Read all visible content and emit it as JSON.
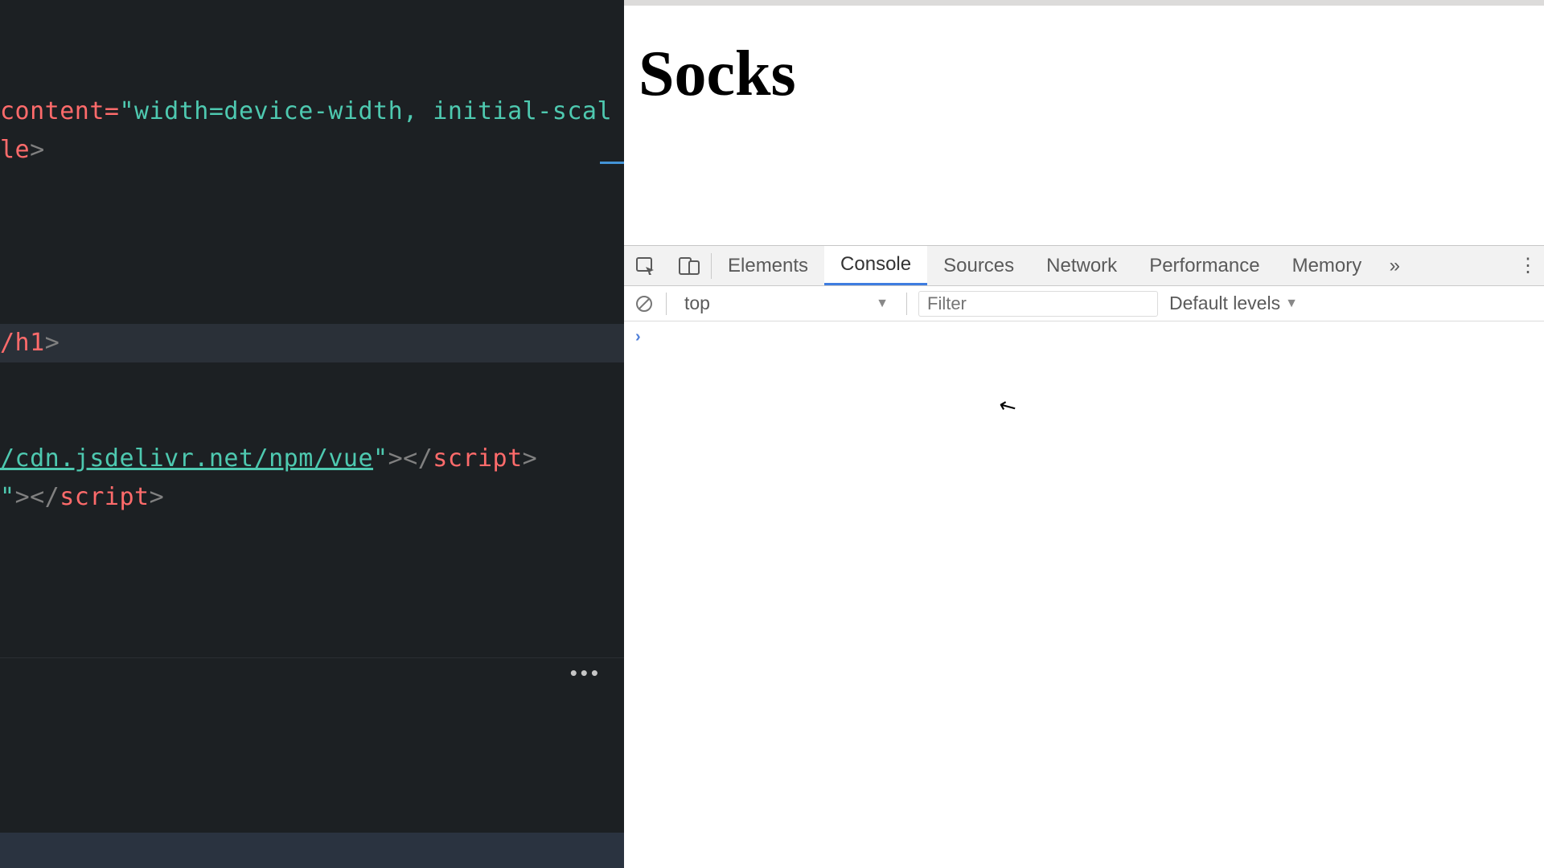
{
  "editor": {
    "lines": [
      {
        "segments": [
          {
            "t": "content=",
            "c": "red"
          },
          {
            "t": "\"width=device-width, initial-scal",
            "c": "teal"
          }
        ]
      },
      {
        "segments": [
          {
            "t": "le",
            "c": "red"
          },
          {
            "t": ">",
            "c": "gray"
          }
        ]
      },
      {
        "segments": []
      },
      {
        "segments": []
      },
      {
        "segments": []
      },
      {
        "segments": []
      },
      {
        "segments": [
          {
            "t": "/h1",
            "c": "red"
          },
          {
            "t": ">",
            "c": "gray"
          }
        ],
        "current": true
      },
      {
        "segments": []
      },
      {
        "segments": []
      },
      {
        "segments": [
          {
            "t": "/cdn.jsdelivr.net/npm/vue",
            "c": "teal",
            "u": true
          },
          {
            "t": "\"",
            "c": "teal"
          },
          {
            "t": "></",
            "c": "gray"
          },
          {
            "t": "script",
            "c": "red"
          },
          {
            "t": ">",
            "c": "gray"
          }
        ]
      },
      {
        "segments": [
          {
            "t": "\"",
            "c": "teal"
          },
          {
            "t": "></",
            "c": "gray"
          },
          {
            "t": "script",
            "c": "red"
          },
          {
            "t": ">",
            "c": "gray"
          }
        ]
      },
      {
        "segments": []
      },
      {
        "segments": []
      },
      {
        "segments": []
      }
    ],
    "panel_more_glyph": "•••"
  },
  "page": {
    "heading": "Socks"
  },
  "devtools": {
    "tabs": [
      "Elements",
      "Console",
      "Sources",
      "Network",
      "Performance",
      "Memory"
    ],
    "active_tab": "Console",
    "overflow_glyph": "»",
    "kebab_glyph": "⋮",
    "console_toolbar": {
      "context": "top",
      "context_caret": "▼",
      "filter_placeholder": "Filter",
      "levels_label": "Default levels",
      "levels_caret": "▼"
    },
    "prompt_glyph": "›"
  },
  "cursor_glyph": "↖"
}
